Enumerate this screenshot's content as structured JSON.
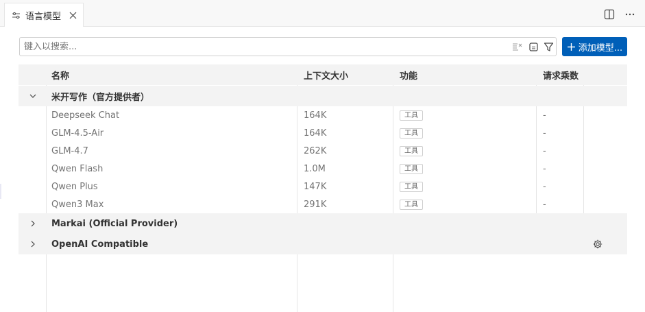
{
  "tab": {
    "title": "语言模型",
    "icon": "sliders-icon"
  },
  "search": {
    "placeholder": "键入以搜索...",
    "value": ""
  },
  "add_button": {
    "label": "添加模型..."
  },
  "columns": {
    "name": "名称",
    "context": "上下文大小",
    "features": "功能",
    "multiplier": "请求乘数"
  },
  "groups": [
    {
      "name": "米开写作（官方提供者）",
      "expanded": true,
      "models": [
        {
          "name": "Deepseek Chat",
          "context": "164K",
          "feature": "工具",
          "multiplier": "-"
        },
        {
          "name": "GLM-4.5-Air",
          "context": "164K",
          "feature": "工具",
          "multiplier": "-"
        },
        {
          "name": "GLM-4.7",
          "context": "262K",
          "feature": "工具",
          "multiplier": "-"
        },
        {
          "name": "Qwen Flash",
          "context": "1.0M",
          "feature": "工具",
          "multiplier": "-"
        },
        {
          "name": "Qwen Plus",
          "context": "147K",
          "feature": "工具",
          "multiplier": "-"
        },
        {
          "name": "Qwen3 Max",
          "context": "291K",
          "feature": "工具",
          "multiplier": "-"
        }
      ]
    },
    {
      "name": "Markai (Official Provider)",
      "expanded": false
    },
    {
      "name": "OpenAI Compatible",
      "expanded": false,
      "has_settings": true
    }
  ],
  "colors": {
    "accent": "#005fb8",
    "row_alt": "#f3f3f3",
    "muted_text": "#737373"
  }
}
